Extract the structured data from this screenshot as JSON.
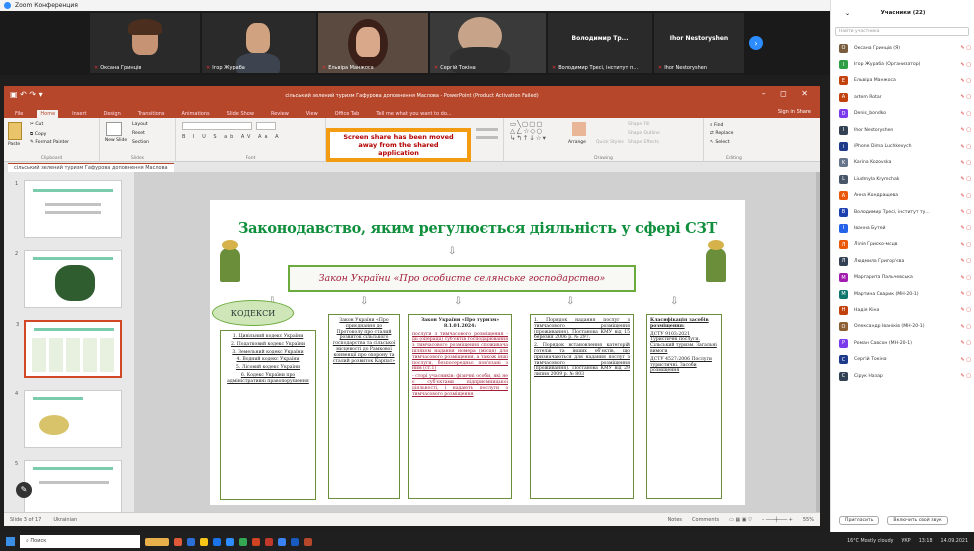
{
  "zoom": {
    "title": "Zoom Конференция",
    "next_icon": "chevron-right-icon"
  },
  "tiles": [
    {
      "name": "Оксана Гринців",
      "type": "video"
    },
    {
      "name": "Ігор Жураба",
      "type": "video"
    },
    {
      "name": "Ельвіра Манжоса",
      "type": "video"
    },
    {
      "name": "Сергій Токіна",
      "type": "video"
    },
    {
      "name": "Володимир Тр...",
      "caption": "Володимир Тресі, інститут п...",
      "type": "name"
    },
    {
      "name": "Ihor Nestoryshen",
      "caption": "Ihor Nestoryshen",
      "type": "name"
    }
  ],
  "ppt": {
    "title": "сільський зелений туризм Гафурова доповнення Маслова - PowerPoint (Product Activation Failed)",
    "tabs": [
      "File",
      "Home",
      "Insert",
      "Design",
      "Transitions",
      "Animations",
      "Slide Show",
      "Review",
      "View",
      "Office Tab",
      "Tell me what you want to do..."
    ],
    "signin": "Sign in  Share",
    "groups": [
      "Clipboard",
      "Slides",
      "Font",
      "Paragraph",
      "Drawing",
      "Editing"
    ],
    "ribbon_items": {
      "cut": "Cut",
      "copy": "Copy",
      "paste": "Paste",
      "format_painter": "Format Painter",
      "new_slide": "New Slide",
      "layout": "Layout",
      "reset": "Reset",
      "section": "Section",
      "find": "Find",
      "replace": "Replace",
      "select": "Select",
      "arrange": "Arrange",
      "quick_styles": "Quick Styles",
      "shape_fill": "Shape Fill",
      "shape_outline": "Shape Outline",
      "shape_effects": "Shape Effects"
    },
    "warning": "Screen share has been moved away from the shared application",
    "doc_tab": "сільський зелений туризм Гафурова доповнення Маслова",
    "status": {
      "slide": "Slide 3 of 17",
      "lang": "Ukrainian",
      "notes": "Notes",
      "comments": "Comments",
      "zoom": "55%"
    }
  },
  "slide": {
    "title": "Законодавство, яким регулюється діяльність у сфері СЗТ",
    "law": "Закон України «Про особисте селянське господарство»",
    "oval": "КОДЕКСИ",
    "col1": [
      "1. Цивільний кодекс України",
      "2. Податковий кодекс України",
      "3. Земельний кодекс України",
      "4. Водний кодекс України",
      "5. Лісовий кодекс України",
      "6. Кодекс України про адміністративні правопорушення"
    ],
    "col2": [
      "Закон України «Про приєднання до Протоколу про сталий розвиток сільського господарства та сільської місцевості до Рамкової конвенції про охорону та сталий розвиток Карпат»"
    ],
    "col3_head": "Закон України «Про туризм» 8.1.01.2024:",
    "col3": [
      "послуги з тимчасового розміщення - дії (операції) суб'єктів господарювання з тимчасового розміщення споживача шляхом надання номера (місця) для тимчасового розміщення, а також інші послуги, безпосередньо пов'язані з ним (ст.1)",
      "- сторі учасників: фізичні особи, які не є суб'єктами підприємницької діяльності, і надають послуги з тимчасового розміщення"
    ],
    "col4": [
      "1. Порядок надання послуг з тимчасового розміщення (проживання). Постанова КМУ від 15 березня 2006 р. № 297.",
      "2. Порядок встановлення категорій готелів та інших об'єктів, що призначаються для надання послуг з тимчасового розміщення (проживання). Постанова КМУ від 29 липня 2009 р. № 803"
    ],
    "col5_head": "Класифікація засобів розміщення:",
    "col5": [
      "ДСТУ 9103:2021 Туристичні послуги. Сільський туризм. Загальні вимоги",
      "ДСТУ 4527:2006 Послуги туристичні. Засоби розміщення"
    ]
  },
  "thumbs": [
    "1",
    "2",
    "3",
    "4",
    "5"
  ],
  "participants": {
    "header": "Учасники (22)",
    "search_placeholder": "Найти участника",
    "list": [
      {
        "name": "Оксана Гринців (Я)",
        "color": "#7a5c3e",
        "init": "О"
      },
      {
        "name": "Ігор Жураба (Организатор)",
        "color": "#2f9e44",
        "init": "І"
      },
      {
        "name": "Ельвіра Манжоса",
        "color": "#c2410c",
        "init": "Е"
      },
      {
        "name": "artem Rotar",
        "color": "#c2410c",
        "init": "A"
      },
      {
        "name": "Denis_bondko",
        "color": "#7c3aed",
        "init": "D"
      },
      {
        "name": "Ihor Nestoryshen",
        "color": "#334155",
        "init": "I"
      },
      {
        "name": "iPhone Dima Luchkevych",
        "color": "#1e3a8a",
        "init": "i"
      },
      {
        "name": "Karina Kozovska",
        "color": "#64748b",
        "init": "K"
      },
      {
        "name": "Liudmyla Krymchak",
        "color": "#475569",
        "init": "L"
      },
      {
        "name": "Анна Кондращева",
        "color": "#ea580c",
        "init": "А"
      },
      {
        "name": "Володимир Тресі, інститут ту...",
        "color": "#1e40af",
        "init": "В"
      },
      {
        "name": "Іванна Бутей",
        "color": "#2563eb",
        "init": "І"
      },
      {
        "name": "Лілія Гриско-мсцв",
        "color": "#ea580c",
        "init": "Л"
      },
      {
        "name": "Людмила Григор'єва",
        "color": "#334155",
        "init": "Л"
      },
      {
        "name": "Маргарита Пальчевська",
        "color": "#a21caf",
        "init": "М"
      },
      {
        "name": "Мартина Сварик (МН-20-1)",
        "color": "#0f766e",
        "init": "М"
      },
      {
        "name": "Надія Кіна",
        "color": "#c2410c",
        "init": "Н"
      },
      {
        "name": "Олександр Іваніків (МН-20-1)",
        "color": "#8b5e34",
        "init": "О"
      },
      {
        "name": "Роман Савсон (МН-20-1)",
        "color": "#7c3aed",
        "init": "Р"
      },
      {
        "name": "Сергій Токіна",
        "color": "#1e3a8a",
        "init": "С"
      },
      {
        "name": "Сірук Назар",
        "color": "#334155",
        "init": "С"
      }
    ],
    "invite": "Пригласить",
    "mute_all": "Включить свой звук"
  },
  "taskbar": {
    "search": "Поиск",
    "weather": "16°C  Mostly cloudy",
    "lang": "УКР",
    "time": "13:18",
    "date": "14.09.2021"
  }
}
